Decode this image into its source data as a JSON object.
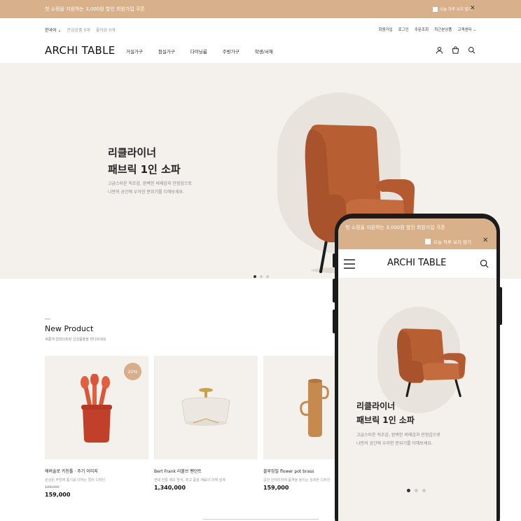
{
  "promo": {
    "text": "첫 쇼핑을 지원하는 3,000원 할인 회원가입 쿠폰",
    "hide_today": "오늘 하루 보지 않기",
    "close": "✕"
  },
  "util": {
    "language": "한국어",
    "recent": "관심상품 0개",
    "wishlist": "좋아요 0개",
    "links": [
      "회원가입",
      "로그인",
      "주문조회",
      "최근본상품",
      "고객센터"
    ]
  },
  "nav": {
    "logo": "ARCHI TABLE",
    "menu": [
      "거실가구",
      "침실가구",
      "다이닝룸",
      "주방가구",
      "학생/서재"
    ]
  },
  "hero": {
    "title_line1": "리클라이너",
    "title_line2": "패브릭 1인 소파",
    "desc_line1": "고급스러운 직조감, 완벽한 비례감과 안정감으로",
    "desc_line2": "나만의 공간에 우아한 분위기를 더해보세요.",
    "slide_count": 3,
    "active_slide": 1
  },
  "new_product": {
    "title": "New Product",
    "subtitle": "새롭게 업데이트된 신상품들을 만나보세요",
    "products": [
      {
        "name": "에버솔로 키친툴 · 주기 이미지",
        "desc": "원심은 주방에 품기를 더하는 컬러 디자인",
        "old_price": "198,000",
        "price": "159,000",
        "badge": "20%"
      },
      {
        "name": "Bert Frank 리볼브 펜던트",
        "desc": "현대 전통 제조 방식, 최고 품질 재료의 의해 설계",
        "old_price": "",
        "price": "1,340,000",
        "badge": ""
      },
      {
        "name": "블루밍빌 flower pot brass",
        "desc": "공간 인테리어에 품격을 높이는 섬세한 디자인",
        "old_price": "",
        "price": "159,000",
        "badge": ""
      }
    ]
  },
  "mobile": {
    "promo_text": "첫 쇼핑을 지원하는 3,000원 할인 회원가입 쿠폰",
    "hide_today": "오늘 하루 보지 않기",
    "close": "✕",
    "logo": "ARCHI TABLE",
    "hero_title_line1": "리클라이너",
    "hero_title_line2": "패브릭 1인 소파",
    "hero_desc_line1": "고급스러운 직조감, 완벽한 비례감과 안정감으로",
    "hero_desc_line2": "나만의 공간에 우아한 분위기를 더해보세요."
  },
  "colors": {
    "accent": "#d8b08a",
    "hero_bg": "#f4f1ec",
    "sofa": "#c0683a"
  },
  "icons": {
    "user": "user-icon",
    "cart": "cart-icon",
    "search": "search-icon",
    "menu": "hamburger-icon",
    "close": "close-icon",
    "chevron": "chevron-down-icon"
  }
}
